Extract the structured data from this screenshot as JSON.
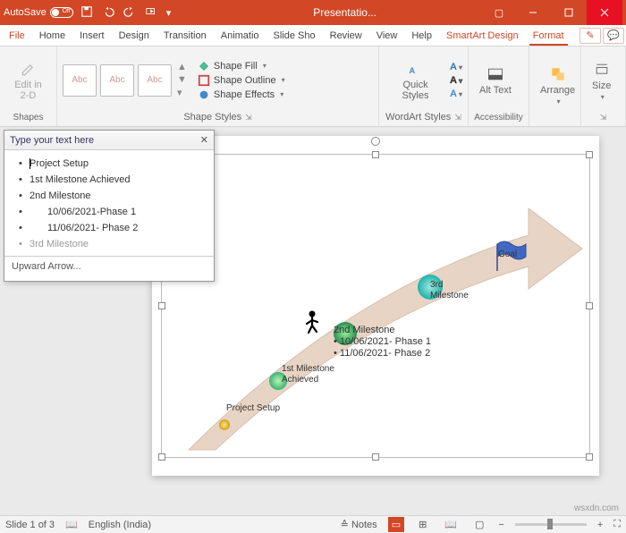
{
  "titlebar": {
    "autosave": "AutoSave",
    "autosave_state": "Off",
    "title": "Presentatio..."
  },
  "menu": {
    "file": "File",
    "home": "Home",
    "insert": "Insert",
    "design": "Design",
    "transitions": "Transition",
    "animations": "Animatio",
    "slideshow": "Slide Sho",
    "review": "Review",
    "view": "View",
    "help": "Help",
    "smartart_design": "SmartArt Design",
    "format": "Format"
  },
  "ribbon": {
    "shapes": {
      "edit2d": "Edit in 2-D",
      "label": "Shapes"
    },
    "shape_styles": {
      "abc": "Abc",
      "fill": "Shape Fill",
      "outline": "Shape Outline",
      "effects": "Shape Effects",
      "label": "Shape Styles"
    },
    "wordart": {
      "quick_styles": "Quick Styles",
      "label": "WordArt Styles"
    },
    "accessibility": {
      "alt_text": "Alt Text",
      "label": "Accessibility"
    },
    "arrange": {
      "arrange": "Arrange",
      "label": ""
    },
    "size": {
      "size": "Size",
      "label": ""
    }
  },
  "textpane": {
    "header": "Type your text here",
    "items": [
      "Project Setup",
      "1st Milestone Achieved",
      "2nd Milestone",
      "10/06/2021-Phase 1",
      "11/06/2021- Phase 2",
      "3rd Milestone"
    ],
    "footer": "Upward Arrow..."
  },
  "slide": {
    "labels": {
      "project_setup": "Project Setup",
      "m1": "1st Milestone Achieved",
      "m2": "2nd Milestone",
      "m2_b1": "• 10/06/2021- Phase 1",
      "m2_b2": "• 11/06/2021- Phase 2",
      "m3": "3rd Milestone",
      "goal": "Goal"
    }
  },
  "statusbar": {
    "slide": "Slide 1 of 3",
    "lang": "English (India)",
    "notes": "Notes"
  },
  "watermark": "wsxdn.com"
}
